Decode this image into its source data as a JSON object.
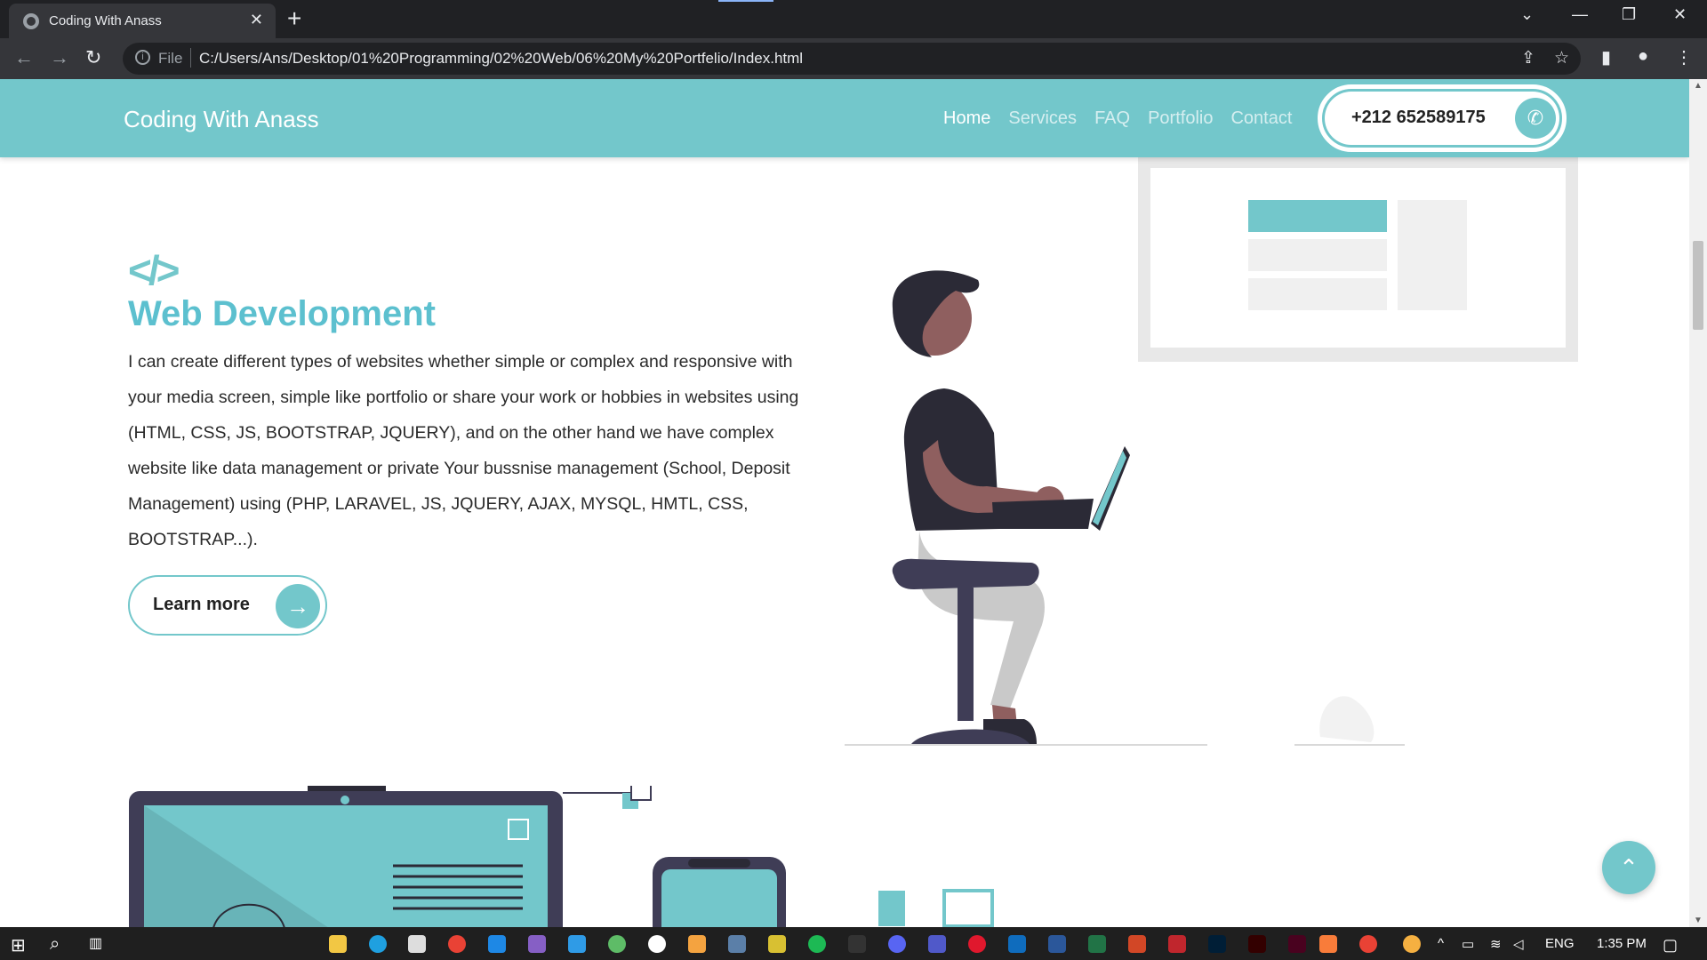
{
  "browser": {
    "tab_title": "Coding With Anass",
    "address_prefix": "File",
    "url": "C:/Users/Ans/Desktop/01%20Programming/02%20Web/06%20My%20Portfelio/Index.html"
  },
  "header": {
    "brand": "Coding With Anass",
    "nav": [
      "Home",
      "Services",
      "FAQ",
      "Portfolio",
      "Contact"
    ],
    "phone": "+212 652589175"
  },
  "section": {
    "title": "Web Development",
    "description": "I can create different types of websites whether simple or complex and responsive with your media screen, simple like portfolio or share your work or hobbies in websites using (HTML, CSS, JS, BOOTSTRAP, JQUERY), and on the other hand we have complex website like data management or private Your bussnise management (School, Deposit Management) using (PHP, LARAVEL, JS, JQUERY, AJAX, MYSQL, HMTL, CSS, BOOTSTRAP...).",
    "button_label": "Learn more"
  },
  "taskbar": {
    "language": "ENG",
    "time": "1:35 PM"
  },
  "colors": {
    "accent": "#73c7cb",
    "title": "#5cc0cf",
    "dark": "#2b2a36"
  }
}
